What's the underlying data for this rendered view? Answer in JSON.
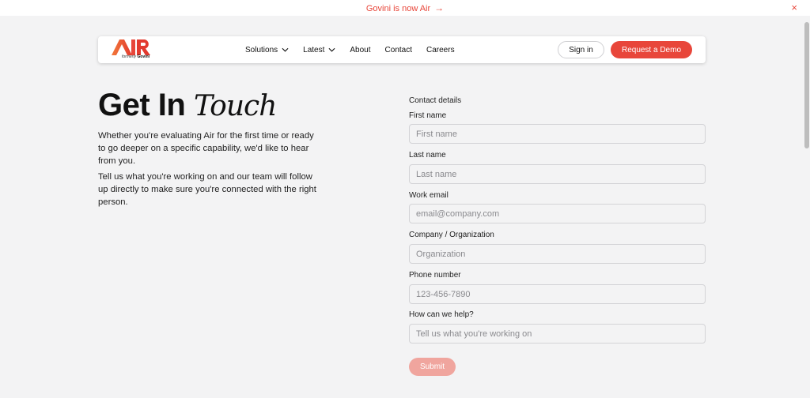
{
  "announcement": {
    "text": "Govini is now Air",
    "arrow": "→",
    "close": "×",
    "color": "#e8463a"
  },
  "nav": {
    "logo_text": "AIR",
    "logo_tagline_prefix": "formerly",
    "logo_tagline_brand": "Govini",
    "items": [
      {
        "label": "Solutions",
        "has_dropdown": true
      },
      {
        "label": "Latest",
        "has_dropdown": true
      },
      {
        "label": "About",
        "has_dropdown": false
      },
      {
        "label": "Contact",
        "has_dropdown": false
      },
      {
        "label": "Careers",
        "has_dropdown": false
      }
    ],
    "signin_label": "Sign in",
    "demo_label": "Request a Demo",
    "accent_color": "#e8463a"
  },
  "hero": {
    "title_main": "Get In",
    "title_italic": "Touch",
    "paragraph_1": "Whether you're evaluating Air for the first time or ready to go deeper on a specific capability, we'd like to hear from you.",
    "paragraph_2": "Tell us what you're working on and our team will follow up directly to make sure you're connected with the right person."
  },
  "form": {
    "heading": "Contact details",
    "fields": [
      {
        "label": "First name",
        "placeholder": "First name",
        "value": ""
      },
      {
        "label": "Last name",
        "placeholder": "Last name",
        "value": ""
      },
      {
        "label": "Work email",
        "placeholder": "email@company.com",
        "value": ""
      },
      {
        "label": "Company / Organization",
        "placeholder": "Organization",
        "value": ""
      },
      {
        "label": "Phone number",
        "placeholder": "123-456-7890",
        "value": ""
      },
      {
        "label": "How can we help?",
        "placeholder": "Tell us what you're working on",
        "value": ""
      }
    ],
    "submit_label": "Submit",
    "submit_color": "#f0a59e"
  }
}
